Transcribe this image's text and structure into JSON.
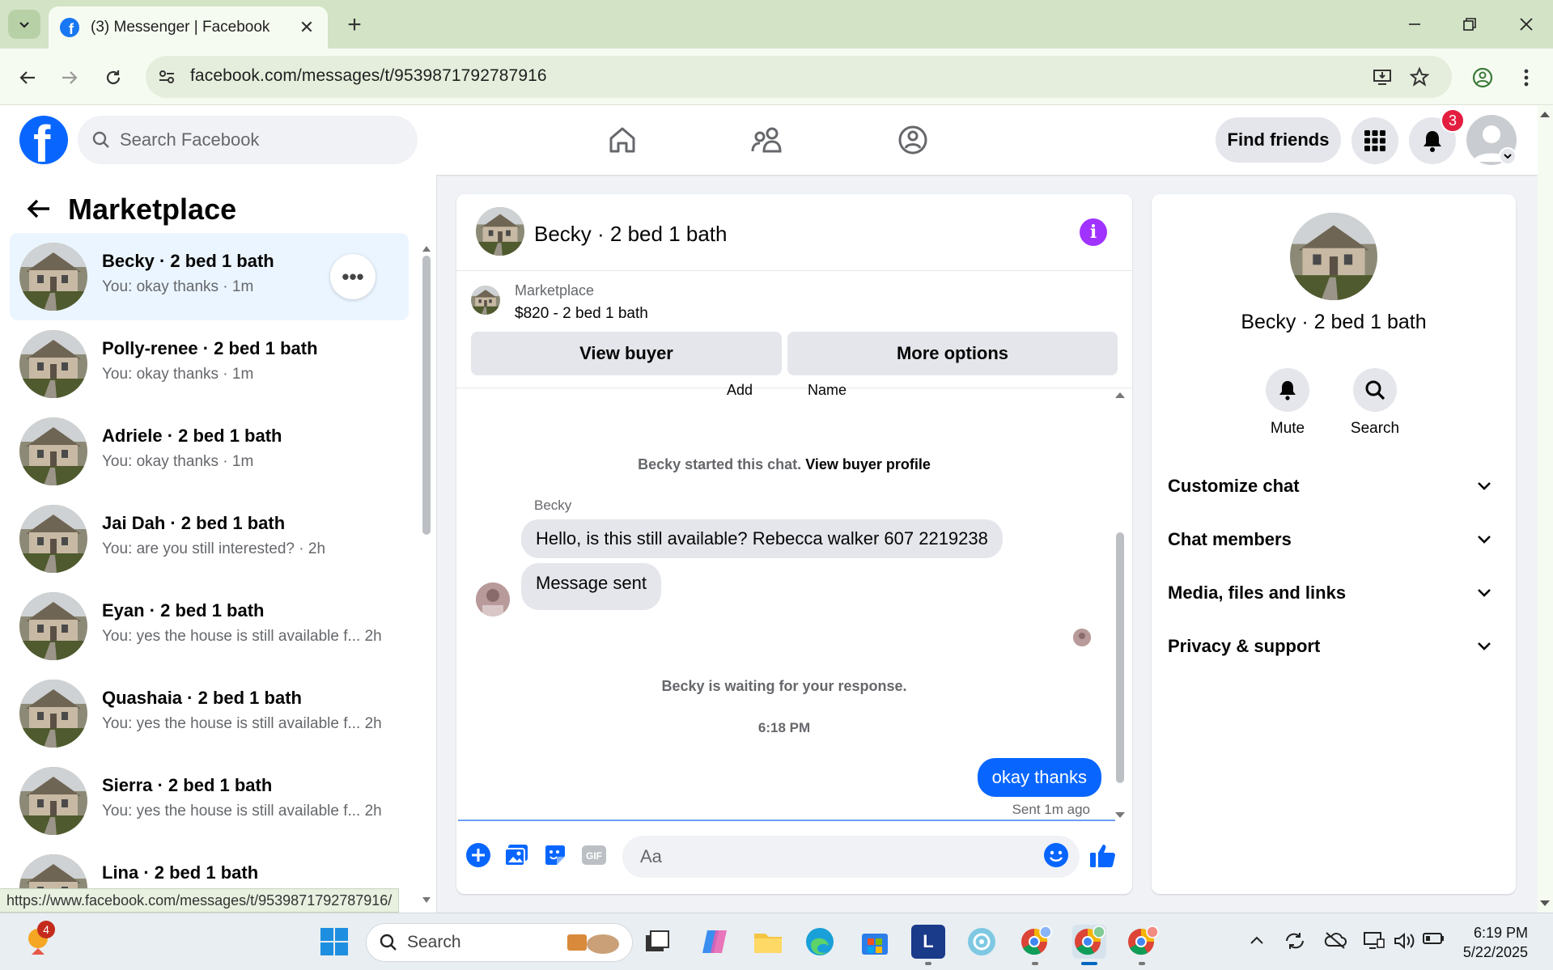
{
  "browser": {
    "tab_title": "(3) Messenger | Facebook",
    "url": "facebook.com/messages/t/9539871792787916",
    "status_url": "https://www.facebook.com/messages/t/9539871792787916/"
  },
  "header": {
    "search_placeholder": "Search Facebook",
    "find_friends": "Find friends",
    "notification_count": "3"
  },
  "sidebar": {
    "title": "Marketplace",
    "conversations": [
      {
        "name": "Becky · 2 bed 1 bath",
        "snippet": "You: okay thanks · 1m",
        "active": true
      },
      {
        "name": "Polly-renee · 2 bed 1 bath",
        "snippet": "You: okay thanks · 1m"
      },
      {
        "name": "Adriele · 2 bed 1 bath",
        "snippet": "You: okay thanks · 1m"
      },
      {
        "name": "Jai Dah · 2 bed 1 bath",
        "snippet": "You: are you still interested? · 2h"
      },
      {
        "name": "Eyan · 2 bed 1 bath",
        "snippet": "You: yes the house is still available f...  2h"
      },
      {
        "name": "Quashaia · 2 bed 1 bath",
        "snippet": "You: yes the house is still available f...  2h"
      },
      {
        "name": "Sierra · 2 bed 1 bath",
        "snippet": "You: yes the house is still available f...  2h"
      },
      {
        "name": "Lina · 2 bed 1 bath",
        "snippet": ""
      }
    ]
  },
  "chat": {
    "title": "Becky · 2 bed 1 bath",
    "listing_label": "Marketplace",
    "listing_price": "$820 - 2 bed 1 bath",
    "view_buyer": "View buyer",
    "more_options": "More options",
    "clipped_add": "Add",
    "clipped_name": "Name",
    "started_text": "Becky started this chat.",
    "view_buyer_profile": "View buyer profile",
    "sender_name": "Becky",
    "incoming": [
      "Hello, is this still available? Rebecca walker 607 2219238",
      "Message sent"
    ],
    "waiting_text": "Becky is waiting for your response.",
    "time_separator": "6:18 PM",
    "outgoing": "okay thanks",
    "sent_status": "Sent 1m ago",
    "composer_placeholder": "Aa"
  },
  "info_panel": {
    "name": "Becky · 2 bed 1 bath",
    "mute": "Mute",
    "search": "Search",
    "rows": [
      "Customize chat",
      "Chat members",
      "Media, files and links",
      "Privacy & support"
    ]
  },
  "taskbar": {
    "search_label": "Search",
    "notification_badge": "4",
    "time": "6:19 PM",
    "date": "5/22/2025"
  },
  "colors": {
    "fb_blue": "#0866ff",
    "messenger_purple": "#a033ff",
    "browser_frame": "#d3e3c6",
    "badge_red": "#e41e3f"
  }
}
